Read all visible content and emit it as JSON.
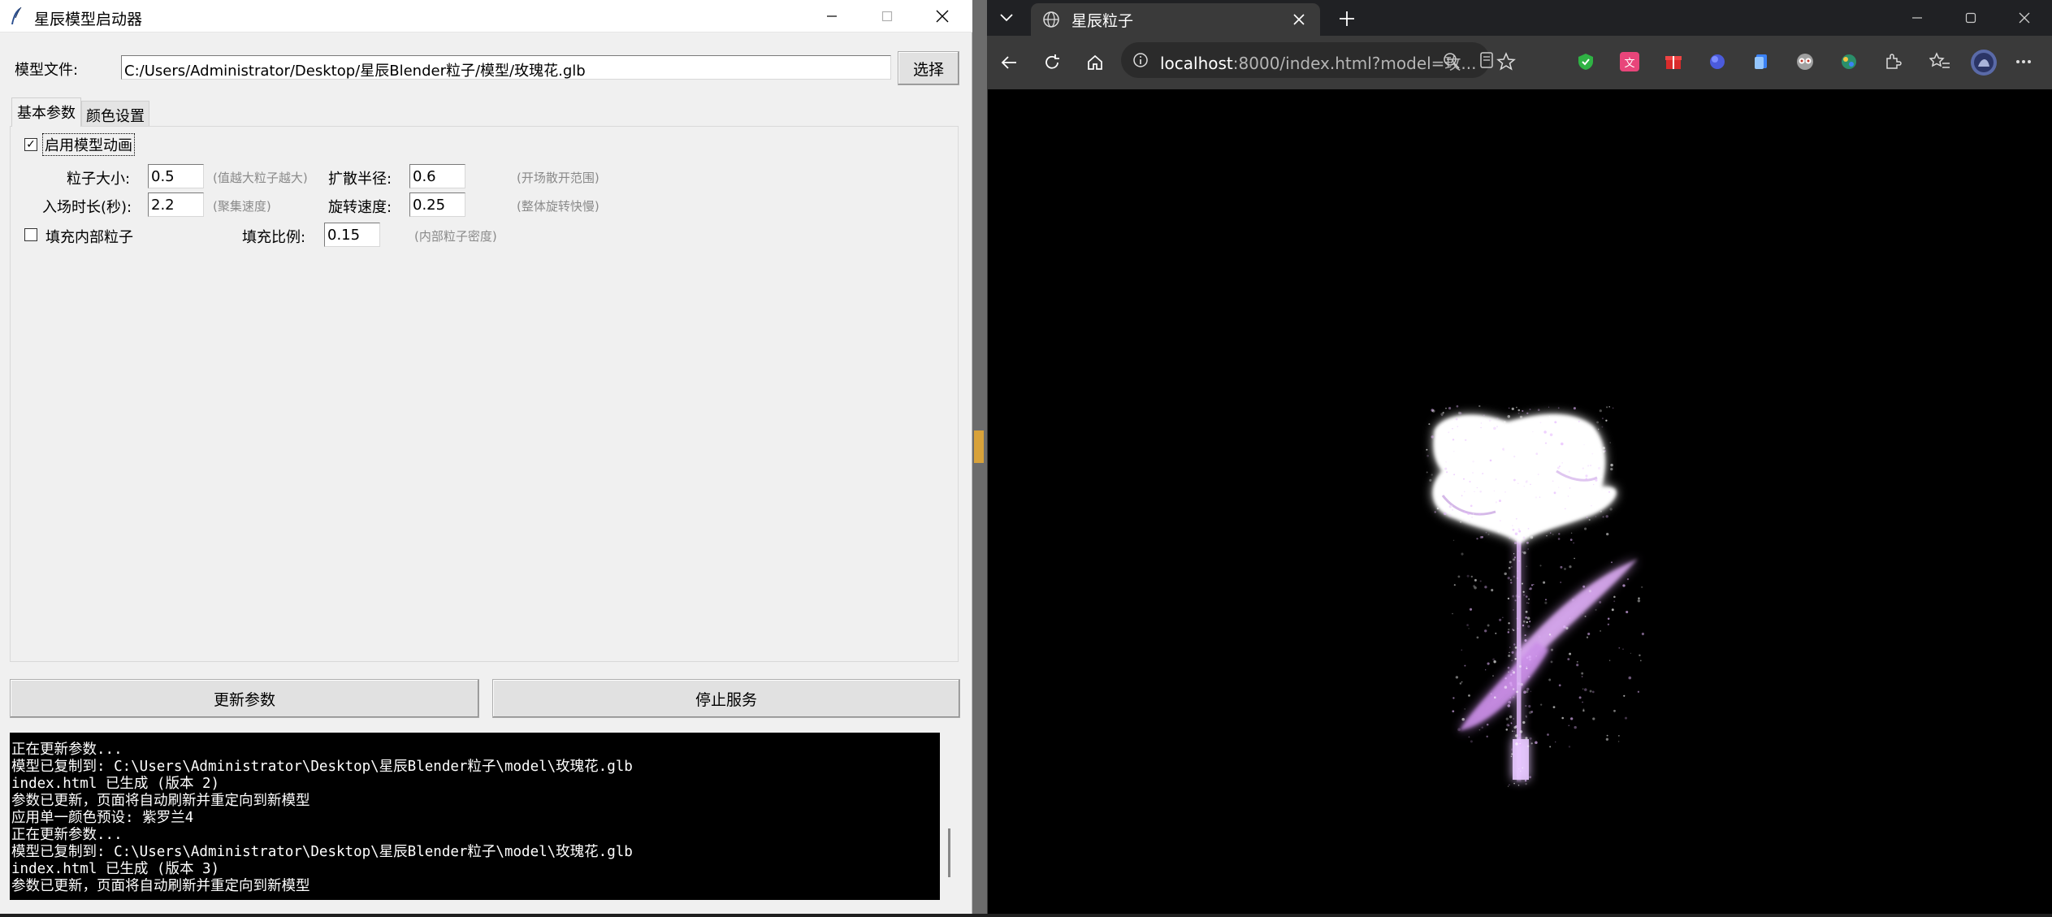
{
  "tk_window": {
    "title": "星辰模型启动器",
    "model_file_label": "模型文件:",
    "model_file_value": "C:/Users/Administrator/Desktop/星辰Blender粒子/模型/玫瑰花.glb",
    "choose_button": "选择",
    "tabs": [
      "基本参数",
      "颜色设置"
    ],
    "enable_animation_label": "启用模型动画",
    "enable_animation_checked": true,
    "particle_size_label": "粒子大小:",
    "particle_size_value": "0.5",
    "particle_size_hint": "(值越大粒子越大)",
    "spread_radius_label": "扩散半径:",
    "spread_radius_value": "0.6",
    "spread_radius_hint": "(开场散开范围)",
    "entry_duration_label": "入场时长(秒):",
    "entry_duration_value": "2.2",
    "entry_duration_hint": "(聚集速度)",
    "rotation_speed_label": "旋转速度:",
    "rotation_speed_value": "0.25",
    "rotation_speed_hint": "(整体旋转快慢)",
    "fill_inner_label": "填充内部粒子",
    "fill_inner_checked": false,
    "fill_ratio_label": "填充比例:",
    "fill_ratio_value": "0.15",
    "fill_ratio_hint": "(内部粒子密度)",
    "update_button": "更新参数",
    "stop_button": "停止服务",
    "console_lines": [
      "正在更新参数...",
      "模型已复制到: C:\\Users\\Administrator\\Desktop\\星辰Blender粒子\\model\\玫瑰花.glb",
      "index.html 已生成 (版本 2)",
      "参数已更新，页面将自动刷新并重定向到新模型",
      "应用单一颜色预设: 紫罗兰4",
      "正在更新参数...",
      "模型已复制到: C:\\Users\\Administrator\\Desktop\\星辰Blender粒子\\model\\玫瑰花.glb",
      "index.html 已生成 (版本 3)",
      "参数已更新，页面将自动刷新并重定向到新模型"
    ]
  },
  "browser": {
    "tab_title": "星辰粒子",
    "address_host": "localhost",
    "address_rest": ":8000/index.html?model=玫...",
    "particle_color": "#e6b8ff"
  }
}
